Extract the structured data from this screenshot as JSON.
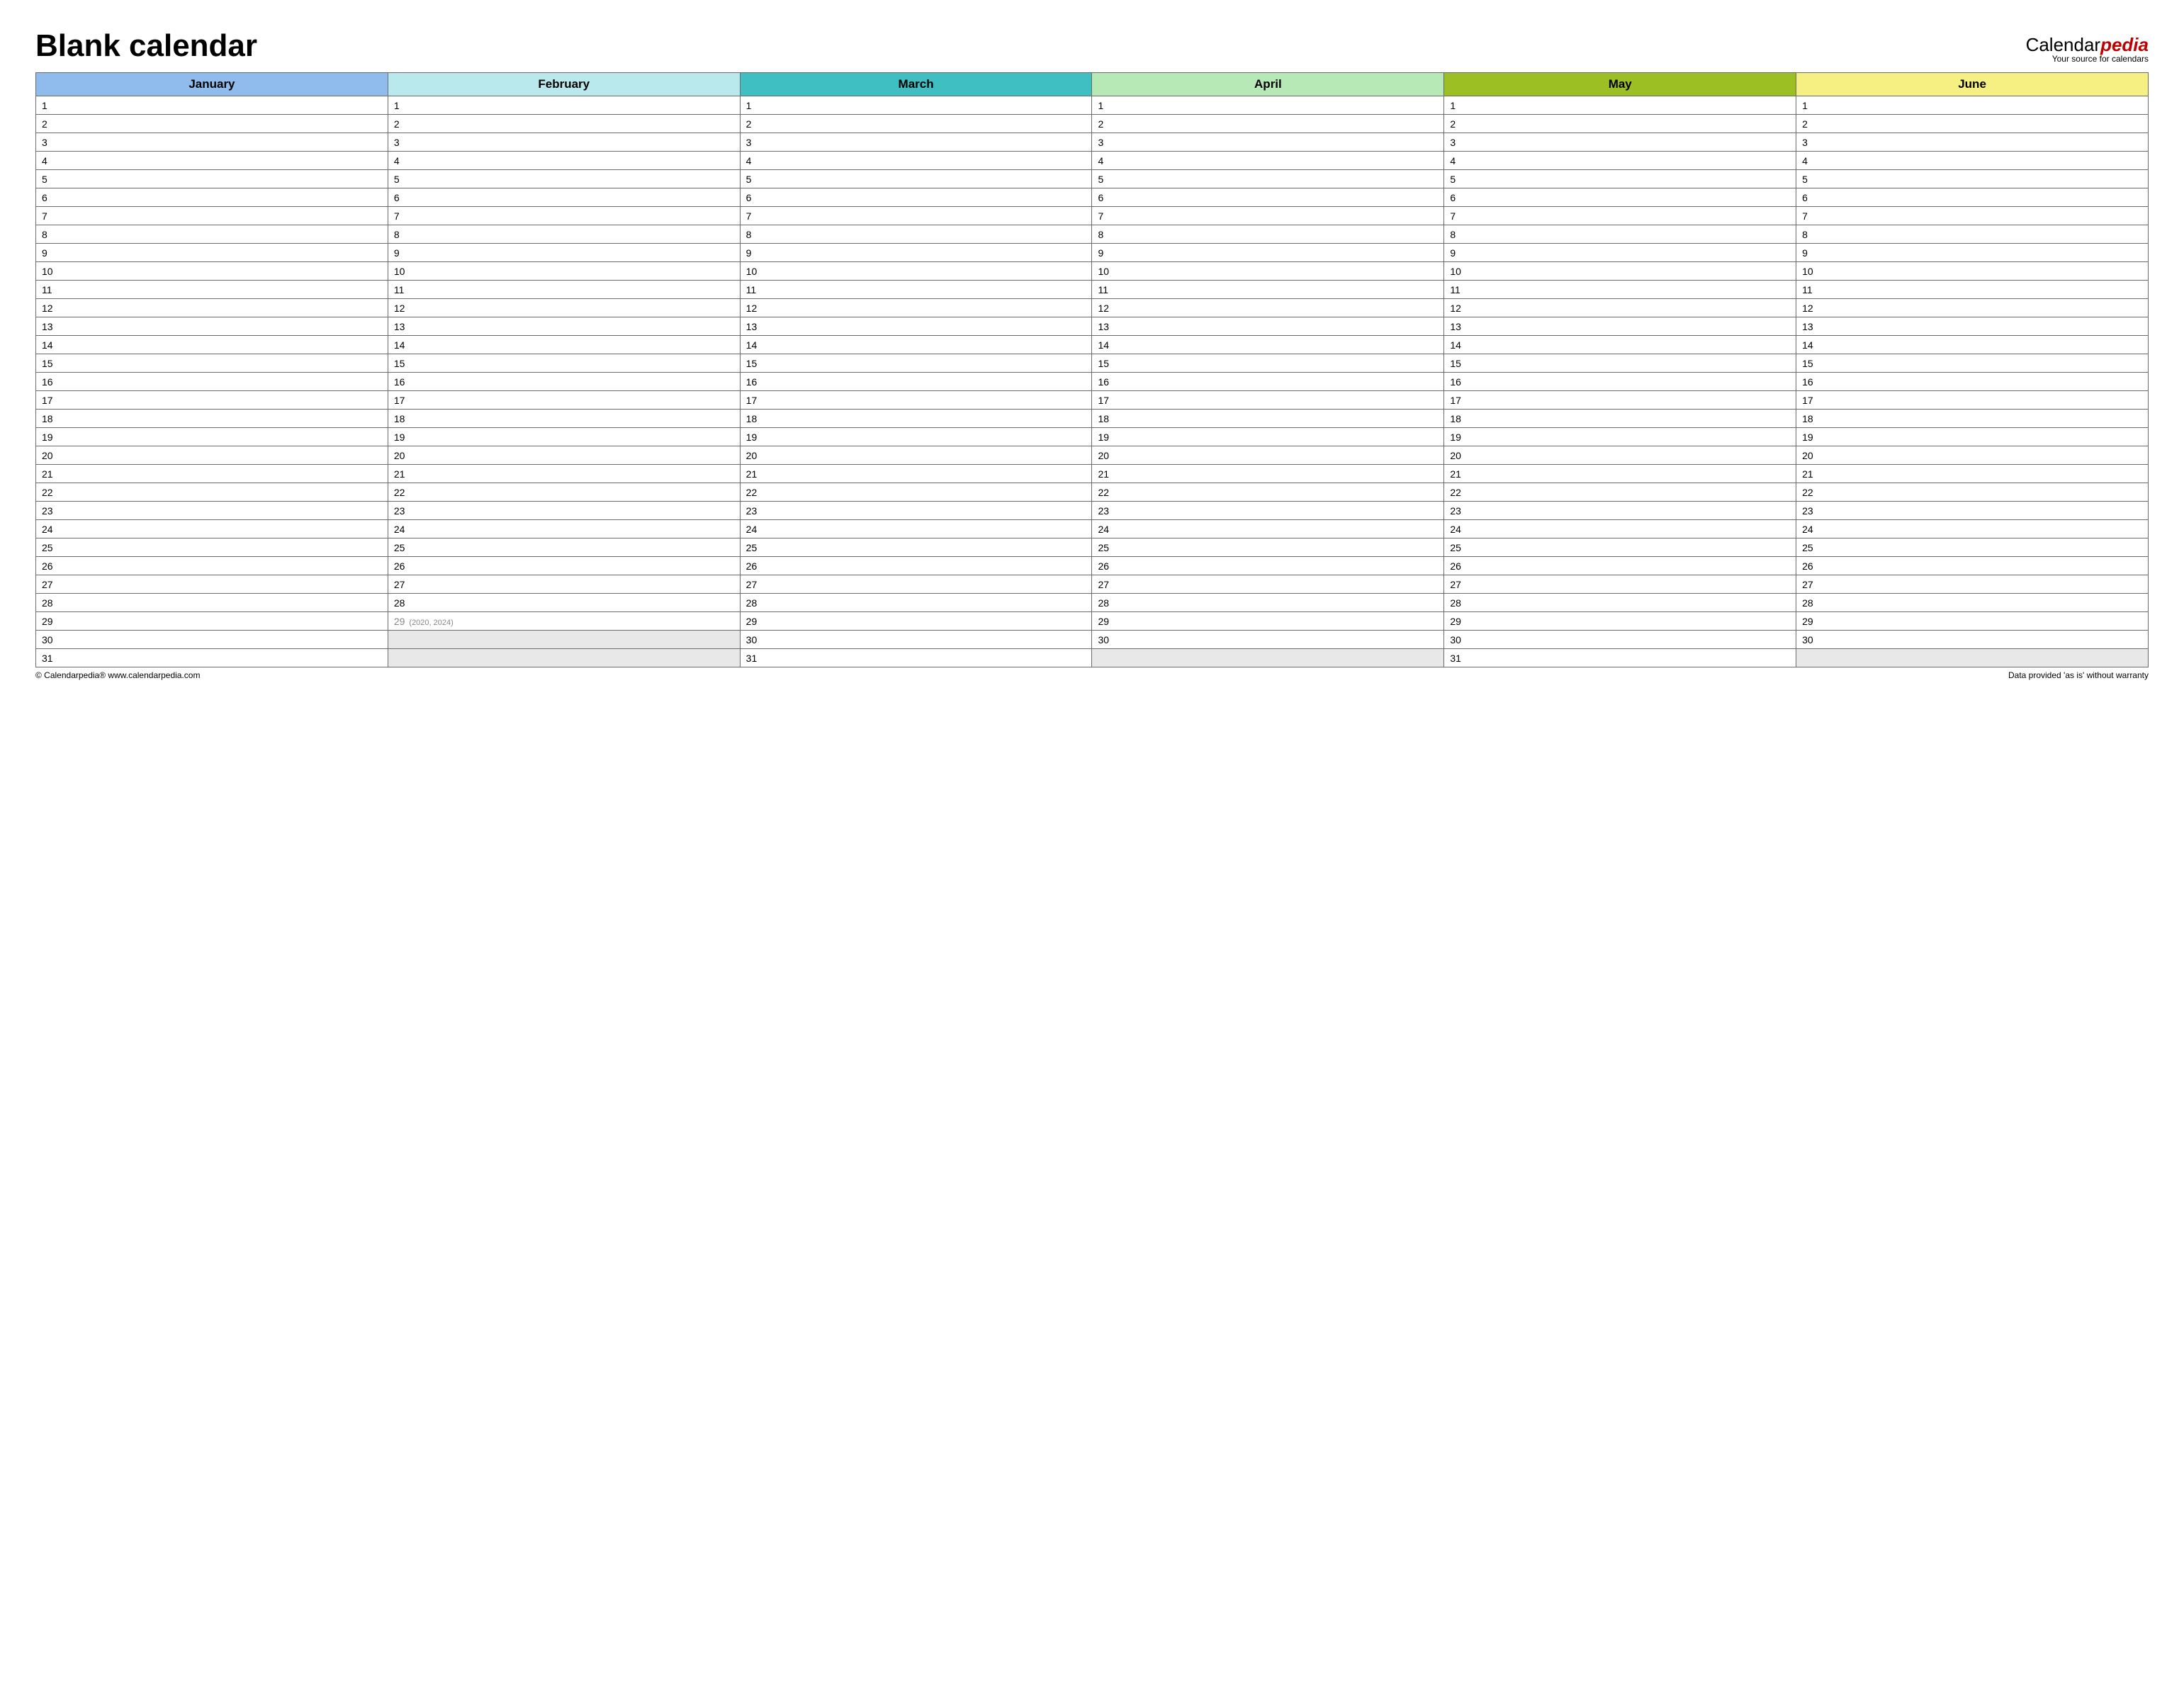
{
  "title": "Blank calendar",
  "brand": {
    "prefix": "Calendar",
    "accent": "pedia",
    "tagline": "Your source for calendars"
  },
  "months": [
    {
      "name": "January",
      "css": "col-jan",
      "days": 31,
      "leap": null
    },
    {
      "name": "February",
      "css": "col-feb",
      "days": 28,
      "leap": {
        "day": 29,
        "note": "(2020, 2024)"
      }
    },
    {
      "name": "March",
      "css": "col-mar",
      "days": 31,
      "leap": null
    },
    {
      "name": "April",
      "css": "col-apr",
      "days": 30,
      "leap": null
    },
    {
      "name": "May",
      "css": "col-may",
      "days": 31,
      "leap": null
    },
    {
      "name": "June",
      "css": "col-jun",
      "days": 30,
      "leap": null
    }
  ],
  "max_rows": 31,
  "footer": {
    "left": "© Calendarpedia®   www.calendarpedia.com",
    "right": "Data provided 'as is' without warranty"
  }
}
